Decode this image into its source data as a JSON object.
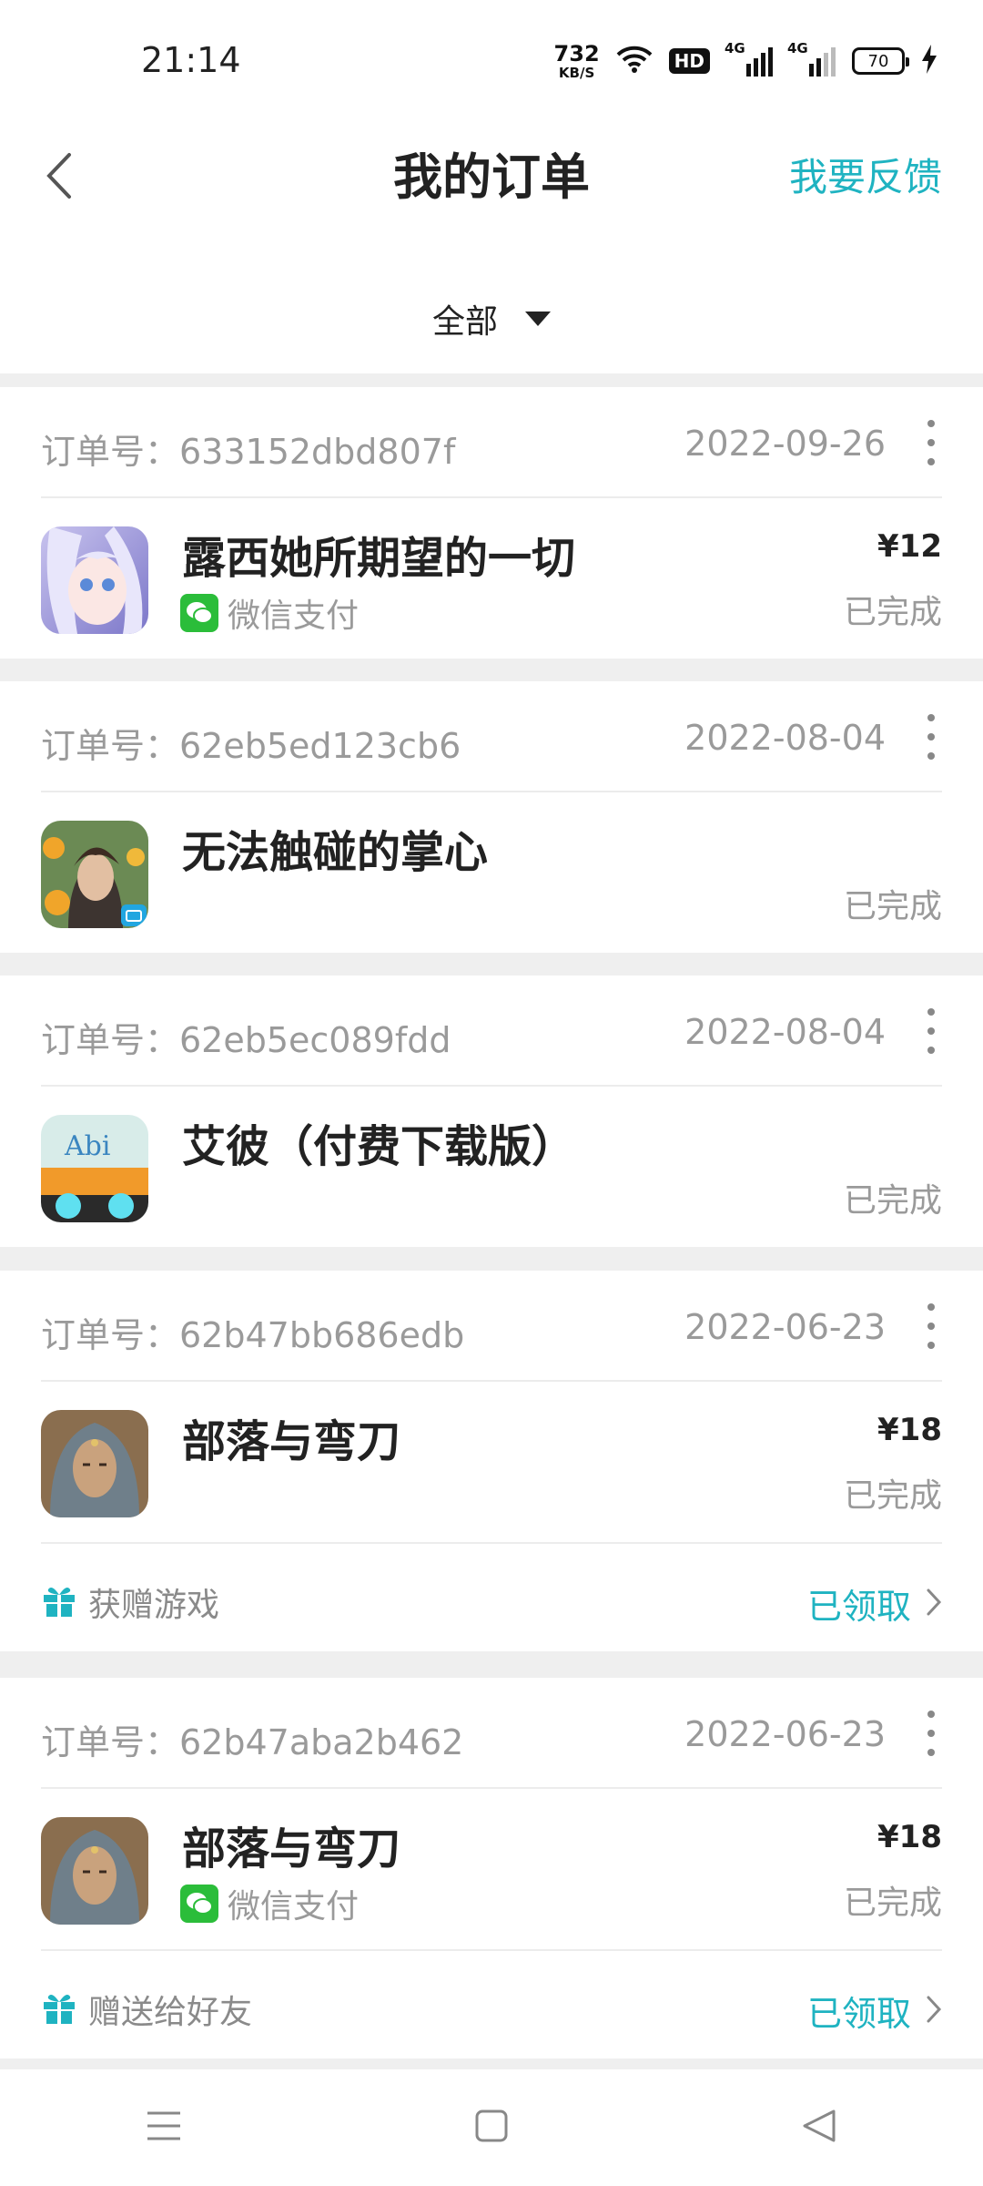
{
  "status_bar": {
    "time": "21:14",
    "net_speed_value": "732",
    "net_speed_unit": "KB/S",
    "hd_label": "HD",
    "sig1_label": "4G",
    "sig2_label": "4G",
    "battery": "70"
  },
  "header": {
    "title": "我的订单",
    "feedback_label": "我要反馈",
    "filter_label": "全部"
  },
  "orders": [
    {
      "order_label": "订单号：633152dbd807f",
      "date": "2022-09-26",
      "game_name": "露西她所期望的一切",
      "pay_method": "微信支付",
      "price": "¥12",
      "status": "已完成"
    },
    {
      "order_label": "订单号：62eb5ed123cb6",
      "date": "2022-08-04",
      "game_name": "无法触碰的掌心",
      "status": "已完成"
    },
    {
      "order_label": "订单号：62eb5ec089fdd",
      "date": "2022-08-04",
      "game_name": "艾彼（付费下载版）",
      "status": "已完成",
      "icon_text": "Abi"
    },
    {
      "order_label": "订单号：62b47bb686edb",
      "date": "2022-06-23",
      "game_name": "部落与弯刀",
      "price": "¥18",
      "status": "已完成",
      "gift_label": "获赠游戏",
      "gift_status": "已领取"
    },
    {
      "order_label": "订单号：62b47aba2b462",
      "date": "2022-06-23",
      "game_name": "部落与弯刀",
      "pay_method": "微信支付",
      "price": "¥18",
      "status": "已完成",
      "gift_label": "赠送给好友",
      "gift_status": "已领取"
    }
  ],
  "colors": {
    "accent": "#1fb3c1",
    "wechat_green": "#2bbd3a",
    "muted_text": "#9a9a9a",
    "background": "#efefef"
  },
  "icons": {
    "back": "chevron-left-icon",
    "more": "more-vertical-icon",
    "pay": "wechat-icon",
    "gift": "gift-icon",
    "arrow": "chevron-right-icon",
    "nav_menu": "menu-icon",
    "nav_home": "home-square-icon",
    "nav_back": "back-triangle-icon"
  }
}
